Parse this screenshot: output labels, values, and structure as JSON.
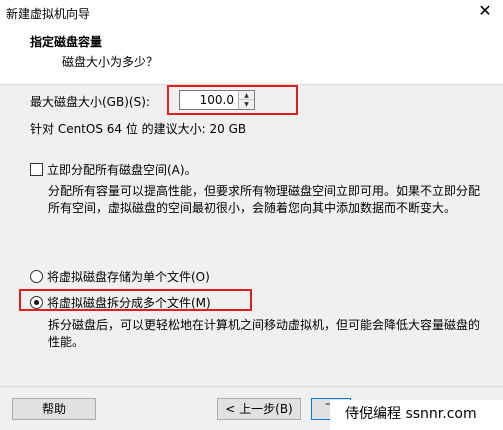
{
  "window": {
    "title": "新建虚拟机向导",
    "close_glyph": "✕"
  },
  "header": {
    "title": "指定磁盘容量",
    "subtitle": "磁盘大小为多少？"
  },
  "disk_size": {
    "label": "最大磁盘大小(GB)(S):",
    "value": "100.0",
    "up_glyph": "▲",
    "down_glyph": "▼"
  },
  "recommend_text": "针对 CentOS 64 位 的建议大小: 20 GB",
  "allocate": {
    "label": "立即分配所有磁盘空间(A)。",
    "checked": false,
    "description": "分配所有容量可以提高性能，但要求所有物理磁盘空间立即可用。如果不立即分配所有空间，虚拟磁盘的空间最初很小，会随着您向其中添加数据而不断变大。"
  },
  "storage_options": [
    {
      "label": "将虚拟磁盘存储为单个文件(O)",
      "selected": false
    },
    {
      "label": "将虚拟磁盘拆分成多个文件(M)",
      "selected": true
    }
  ],
  "split_description": "拆分磁盘后，可以更轻松地在计算机之间移动虚拟机，但可能会降低大容量磁盘的性能。",
  "buttons": {
    "help": "帮助",
    "back": "< 上一步(B)",
    "next": "下"
  },
  "watermark": "侍倪编程 ssnnr.com",
  "colors": {
    "highlight": "#e02020",
    "background": "#f0f0f0"
  }
}
